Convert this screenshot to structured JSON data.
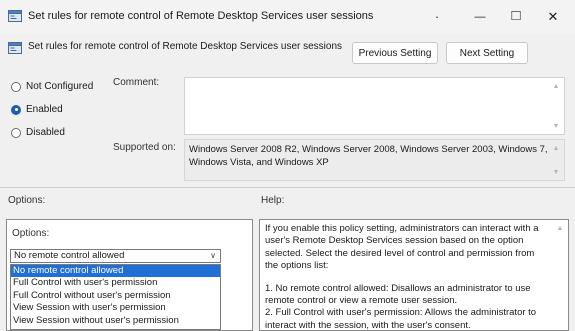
{
  "window": {
    "title": "Set rules for remote control of Remote Desktop Services user sessions",
    "dot": "·",
    "minimize": "—",
    "maximize": "□",
    "close": "✕"
  },
  "header": {
    "title": "Set rules for remote control of Remote Desktop Services user sessions",
    "prev_label": "Previous Setting",
    "next_label": "Next Setting"
  },
  "state": {
    "options": [
      {
        "label": "Not Configured",
        "checked": false
      },
      {
        "label": "Enabled",
        "checked": true
      },
      {
        "label": "Disabled",
        "checked": false
      }
    ]
  },
  "comment": {
    "label": "Comment:",
    "value": ""
  },
  "supported": {
    "label": "Supported on:",
    "value": "Windows Server 2008 R2, Windows Server 2008, Windows Server 2003, Windows 7, Windows Vista, and Windows XP"
  },
  "sections": {
    "options_label": "Options:",
    "help_label": "Help:"
  },
  "options_panel": {
    "label": "Options:",
    "selected": "No remote control allowed",
    "items": [
      "No remote control allowed",
      "Full Control with user's permission",
      "Full Control without user's permission",
      "View Session with user's permission",
      "View Session without user's permission"
    ]
  },
  "help": {
    "paragraphs": [
      "If you enable this policy setting, administrators can interact with a user's Remote Desktop Services session based on the option selected. Select the desired level of control and permission from the options list:",
      "1. No remote control allowed: Disallows an administrator to use remote control or view a remote user session.\n2. Full Control with user's permission: Allows the administrator to interact with the session, with the user's consent."
    ]
  },
  "icons": {
    "app_icon": "policy-settings-icon",
    "header_icon": "policy-settings-icon",
    "scroll_up": "▲",
    "scroll_down": "▼",
    "chevron": "∨"
  },
  "colors": {
    "accent": "#1f6fd6",
    "radio": "#1f5fb0"
  }
}
